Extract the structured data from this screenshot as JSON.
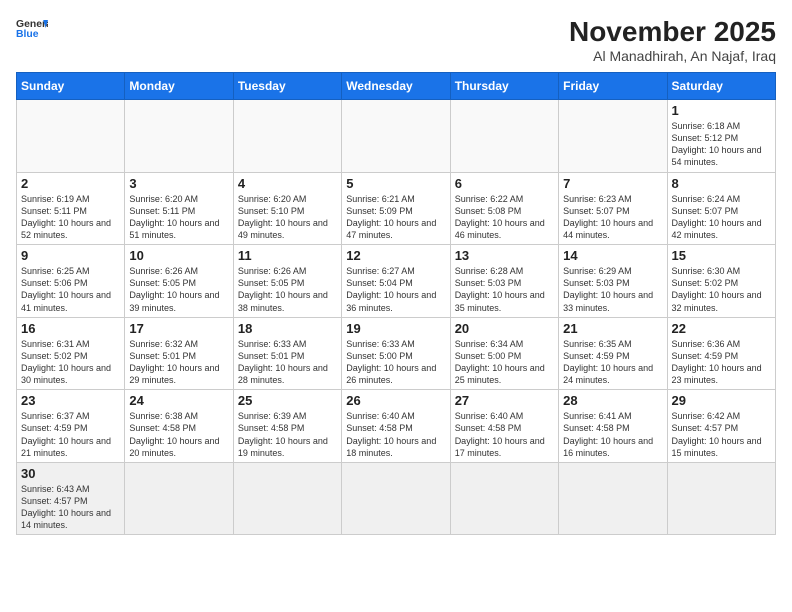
{
  "header": {
    "logo_general": "General",
    "logo_blue": "Blue",
    "month": "November 2025",
    "location": "Al Manadhirah, An Najaf, Iraq"
  },
  "weekdays": [
    "Sunday",
    "Monday",
    "Tuesday",
    "Wednesday",
    "Thursday",
    "Friday",
    "Saturday"
  ],
  "days": {
    "1": {
      "sunrise": "6:18 AM",
      "sunset": "5:12 PM",
      "daylight": "10 hours and 54 minutes."
    },
    "2": {
      "sunrise": "6:19 AM",
      "sunset": "5:11 PM",
      "daylight": "10 hours and 52 minutes."
    },
    "3": {
      "sunrise": "6:20 AM",
      "sunset": "5:11 PM",
      "daylight": "10 hours and 51 minutes."
    },
    "4": {
      "sunrise": "6:20 AM",
      "sunset": "5:10 PM",
      "daylight": "10 hours and 49 minutes."
    },
    "5": {
      "sunrise": "6:21 AM",
      "sunset": "5:09 PM",
      "daylight": "10 hours and 47 minutes."
    },
    "6": {
      "sunrise": "6:22 AM",
      "sunset": "5:08 PM",
      "daylight": "10 hours and 46 minutes."
    },
    "7": {
      "sunrise": "6:23 AM",
      "sunset": "5:07 PM",
      "daylight": "10 hours and 44 minutes."
    },
    "8": {
      "sunrise": "6:24 AM",
      "sunset": "5:07 PM",
      "daylight": "10 hours and 42 minutes."
    },
    "9": {
      "sunrise": "6:25 AM",
      "sunset": "5:06 PM",
      "daylight": "10 hours and 41 minutes."
    },
    "10": {
      "sunrise": "6:26 AM",
      "sunset": "5:05 PM",
      "daylight": "10 hours and 39 minutes."
    },
    "11": {
      "sunrise": "6:26 AM",
      "sunset": "5:05 PM",
      "daylight": "10 hours and 38 minutes."
    },
    "12": {
      "sunrise": "6:27 AM",
      "sunset": "5:04 PM",
      "daylight": "10 hours and 36 minutes."
    },
    "13": {
      "sunrise": "6:28 AM",
      "sunset": "5:03 PM",
      "daylight": "10 hours and 35 minutes."
    },
    "14": {
      "sunrise": "6:29 AM",
      "sunset": "5:03 PM",
      "daylight": "10 hours and 33 minutes."
    },
    "15": {
      "sunrise": "6:30 AM",
      "sunset": "5:02 PM",
      "daylight": "10 hours and 32 minutes."
    },
    "16": {
      "sunrise": "6:31 AM",
      "sunset": "5:02 PM",
      "daylight": "10 hours and 30 minutes."
    },
    "17": {
      "sunrise": "6:32 AM",
      "sunset": "5:01 PM",
      "daylight": "10 hours and 29 minutes."
    },
    "18": {
      "sunrise": "6:33 AM",
      "sunset": "5:01 PM",
      "daylight": "10 hours and 28 minutes."
    },
    "19": {
      "sunrise": "6:33 AM",
      "sunset": "5:00 PM",
      "daylight": "10 hours and 26 minutes."
    },
    "20": {
      "sunrise": "6:34 AM",
      "sunset": "5:00 PM",
      "daylight": "10 hours and 25 minutes."
    },
    "21": {
      "sunrise": "6:35 AM",
      "sunset": "4:59 PM",
      "daylight": "10 hours and 24 minutes."
    },
    "22": {
      "sunrise": "6:36 AM",
      "sunset": "4:59 PM",
      "daylight": "10 hours and 23 minutes."
    },
    "23": {
      "sunrise": "6:37 AM",
      "sunset": "4:59 PM",
      "daylight": "10 hours and 21 minutes."
    },
    "24": {
      "sunrise": "6:38 AM",
      "sunset": "4:58 PM",
      "daylight": "10 hours and 20 minutes."
    },
    "25": {
      "sunrise": "6:39 AM",
      "sunset": "4:58 PM",
      "daylight": "10 hours and 19 minutes."
    },
    "26": {
      "sunrise": "6:40 AM",
      "sunset": "4:58 PM",
      "daylight": "10 hours and 18 minutes."
    },
    "27": {
      "sunrise": "6:40 AM",
      "sunset": "4:58 PM",
      "daylight": "10 hours and 17 minutes."
    },
    "28": {
      "sunrise": "6:41 AM",
      "sunset": "4:58 PM",
      "daylight": "10 hours and 16 minutes."
    },
    "29": {
      "sunrise": "6:42 AM",
      "sunset": "4:57 PM",
      "daylight": "10 hours and 15 minutes."
    },
    "30": {
      "sunrise": "6:43 AM",
      "sunset": "4:57 PM",
      "daylight": "10 hours and 14 minutes."
    }
  }
}
